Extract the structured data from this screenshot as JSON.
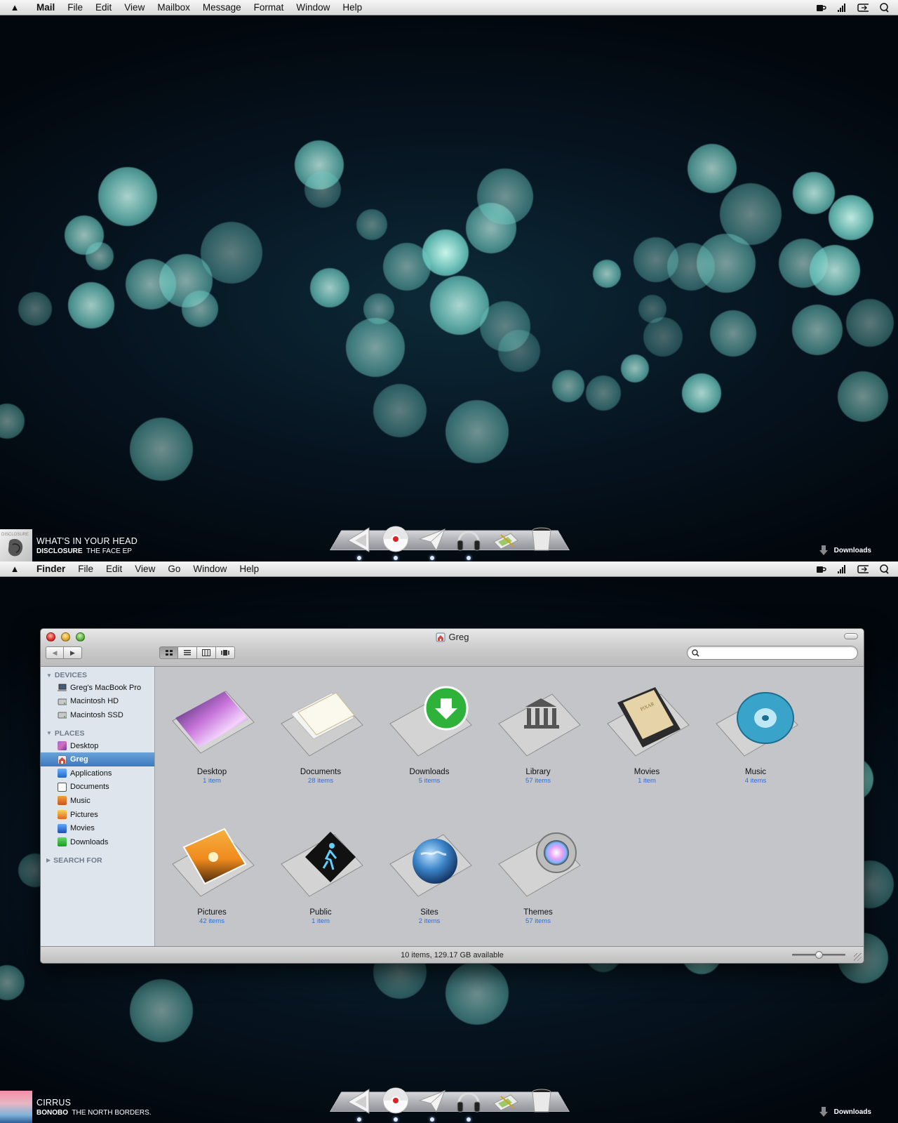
{
  "screen1": {
    "menubar": {
      "app": "Mail",
      "items": [
        "File",
        "Edit",
        "View",
        "Mailbox",
        "Message",
        "Format",
        "Window",
        "Help"
      ]
    },
    "now_playing": {
      "track": "WHAT'S IN YOUR HEAD",
      "artist": "DISCLOSURE",
      "album": "THE FACE EP"
    },
    "downloads_label": "Downloads"
  },
  "screen2": {
    "menubar": {
      "app": "Finder",
      "items": [
        "File",
        "Edit",
        "View",
        "Go",
        "Window",
        "Help"
      ]
    },
    "now_playing": {
      "track": "CIRRUS",
      "artist": "BONOBO",
      "album": "THE NORTH BORDERS."
    },
    "downloads_label": "Downloads",
    "finder": {
      "title": "Greg",
      "search": {
        "value": "",
        "placeholder": ""
      },
      "sidebar": {
        "devices_header": "DEVICES",
        "devices": [
          {
            "label": "Greg's MacBook Pro",
            "icon": "laptop-icon"
          },
          {
            "label": "Macintosh HD",
            "icon": "hard-drive-icon"
          },
          {
            "label": "Macintosh SSD",
            "icon": "hard-drive-icon"
          }
        ],
        "places_header": "PLACES",
        "places": [
          {
            "label": "Desktop",
            "icon": "desktop-icon"
          },
          {
            "label": "Greg",
            "icon": "home-icon",
            "selected": true
          },
          {
            "label": "Applications",
            "icon": "applications-icon"
          },
          {
            "label": "Documents",
            "icon": "documents-icon"
          },
          {
            "label": "Music",
            "icon": "music-icon"
          },
          {
            "label": "Pictures",
            "icon": "pictures-icon"
          },
          {
            "label": "Movies",
            "icon": "movies-icon"
          },
          {
            "label": "Downloads",
            "icon": "downloads-icon"
          }
        ],
        "search_header": "SEARCH FOR"
      },
      "items": [
        {
          "name": "Desktop",
          "count": "1 item",
          "icon": "desktop-folder-icon"
        },
        {
          "name": "Documents",
          "count": "28 items",
          "icon": "documents-folder-icon"
        },
        {
          "name": "Downloads",
          "count": "5 items",
          "icon": "downloads-folder-icon"
        },
        {
          "name": "Library",
          "count": "57 items",
          "icon": "library-folder-icon"
        },
        {
          "name": "Movies",
          "count": "1 item",
          "icon": "movies-folder-icon"
        },
        {
          "name": "Music",
          "count": "4 items",
          "icon": "music-folder-icon"
        },
        {
          "name": "Pictures",
          "count": "42 items",
          "icon": "pictures-folder-icon"
        },
        {
          "name": "Public",
          "count": "1 item",
          "icon": "public-folder-icon"
        },
        {
          "name": "Sites",
          "count": "2 items",
          "icon": "sites-folder-icon"
        },
        {
          "name": "Themes",
          "count": "57 items",
          "icon": "themes-folder-icon"
        }
      ],
      "status": "10 items, 129.17 GB available"
    }
  },
  "dock_icons": [
    "finder-icon",
    "browser-icon",
    "mail-icon",
    "headphones-icon",
    "preview-icon",
    "trash-icon"
  ],
  "colors": {
    "selection": "#3d78bf",
    "item_count": "#2f6fcf",
    "bokeh": "#7fd8d0"
  }
}
